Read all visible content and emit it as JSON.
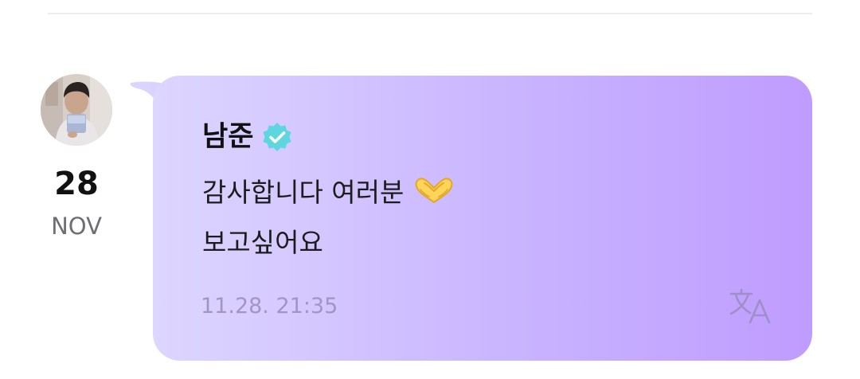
{
  "post": {
    "author": {
      "name": "남준",
      "verified": true,
      "verified_color": "#5ed6e0"
    },
    "date": {
      "day": "28",
      "month": "NOV"
    },
    "message": {
      "line1": "감사합니다 여러분",
      "line1_emoji": "heart-hands-emoji",
      "line2": "보고싶어요"
    },
    "timestamp": "11.28. 21:35",
    "translate_icon": "translate-icon"
  },
  "colors": {
    "bubble_gradient_start": "#ddd6ff",
    "bubble_gradient_end": "#bf9cff",
    "timestamp": "#a295c4",
    "month_text": "#6e6e76"
  }
}
